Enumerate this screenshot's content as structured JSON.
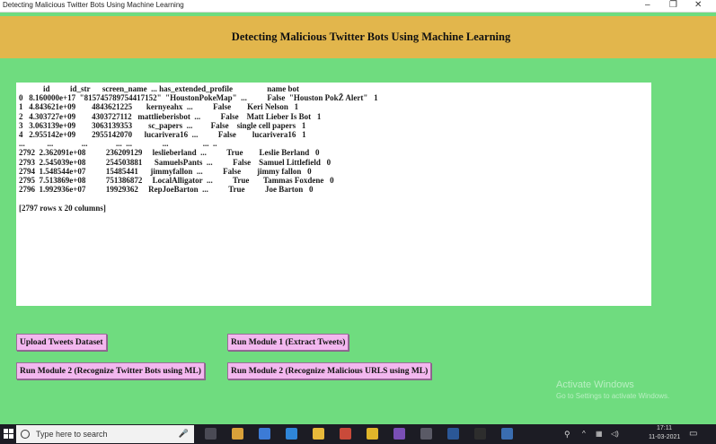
{
  "window": {
    "title": "Detecting Malicious Twitter Bots Using Machine Learning",
    "minimize": "–",
    "maximize": "❐",
    "close": "✕"
  },
  "banner": {
    "title": "Detecting Malicious Twitter Bots Using Machine Learning"
  },
  "output": {
    "lines": [
      "            id          id_str      screen_name  ... has_extended_profile                 name bot",
      "0   8.160000e+17  \"815745789754417152\"  \"HoustonPokeMap\"  ...          False  \"Houston PokŽ Alert\"   1",
      "1   4.843621e+09        4843621225       kernyeahx  ...          False        Keri Nelson   1",
      "2   4.303727e+09        4303727112   mattlieberisbot  ...          False    Matt Lieber Is Bot   1",
      "3   3.063139e+09        3063139353        sc_papers  ...         False    single cell papers   1",
      "4   2.955142e+09        2955142070      lucarivera16  ...          False        lucarivera16   1",
      "...           ...              ...              ...  ...               ...                 ...  ..",
      "2792  2.362091e+08          236209129     leslieberland  ...          True        Leslie Berland   0",
      "2793  2.545039e+08          254503881      SamuelsPants  ...          False    Samuel Littlefield   0",
      "2794  1.548544e+07          15485441      jimmyfallon  ...          False        jimmy fallon   0",
      "2795  7.513869e+08          751386872     LocalAlligator  ...          True       Tammas Foxdene   0",
      "2796  1.992936e+07          19929362     RepJoeBarton  ...          True          Joe Barton   0",
      "",
      "[2797 rows x 20 columns]"
    ]
  },
  "buttons": {
    "upload": "Upload Tweets Dataset",
    "module1": "Run Module 1 (Extract Tweets)",
    "module2_bots": "Run Module 2 (Recognize Twitter Bots using ML)",
    "module2_urls": "Run Module 2 (Recognize Malicious URLS using ML)"
  },
  "watermark": {
    "line1": "Activate Windows",
    "line2": "Go to Settings to activate Windows."
  },
  "taskbar": {
    "search_placeholder": "Type here to search",
    "clock_time": "17:11",
    "clock_date": "11-03-2021",
    "icons": [
      "task-view-icon",
      "store-icon",
      "mail-icon",
      "edge-icon",
      "folder-icon",
      "app-icon",
      "chrome-icon",
      "app2-icon",
      "file-icon",
      "word-icon",
      "terminal-icon",
      "python-icon"
    ]
  },
  "colors": {
    "background": "#6fdc7f",
    "banner": "#e2b64c",
    "button": "#f3b7ef"
  }
}
